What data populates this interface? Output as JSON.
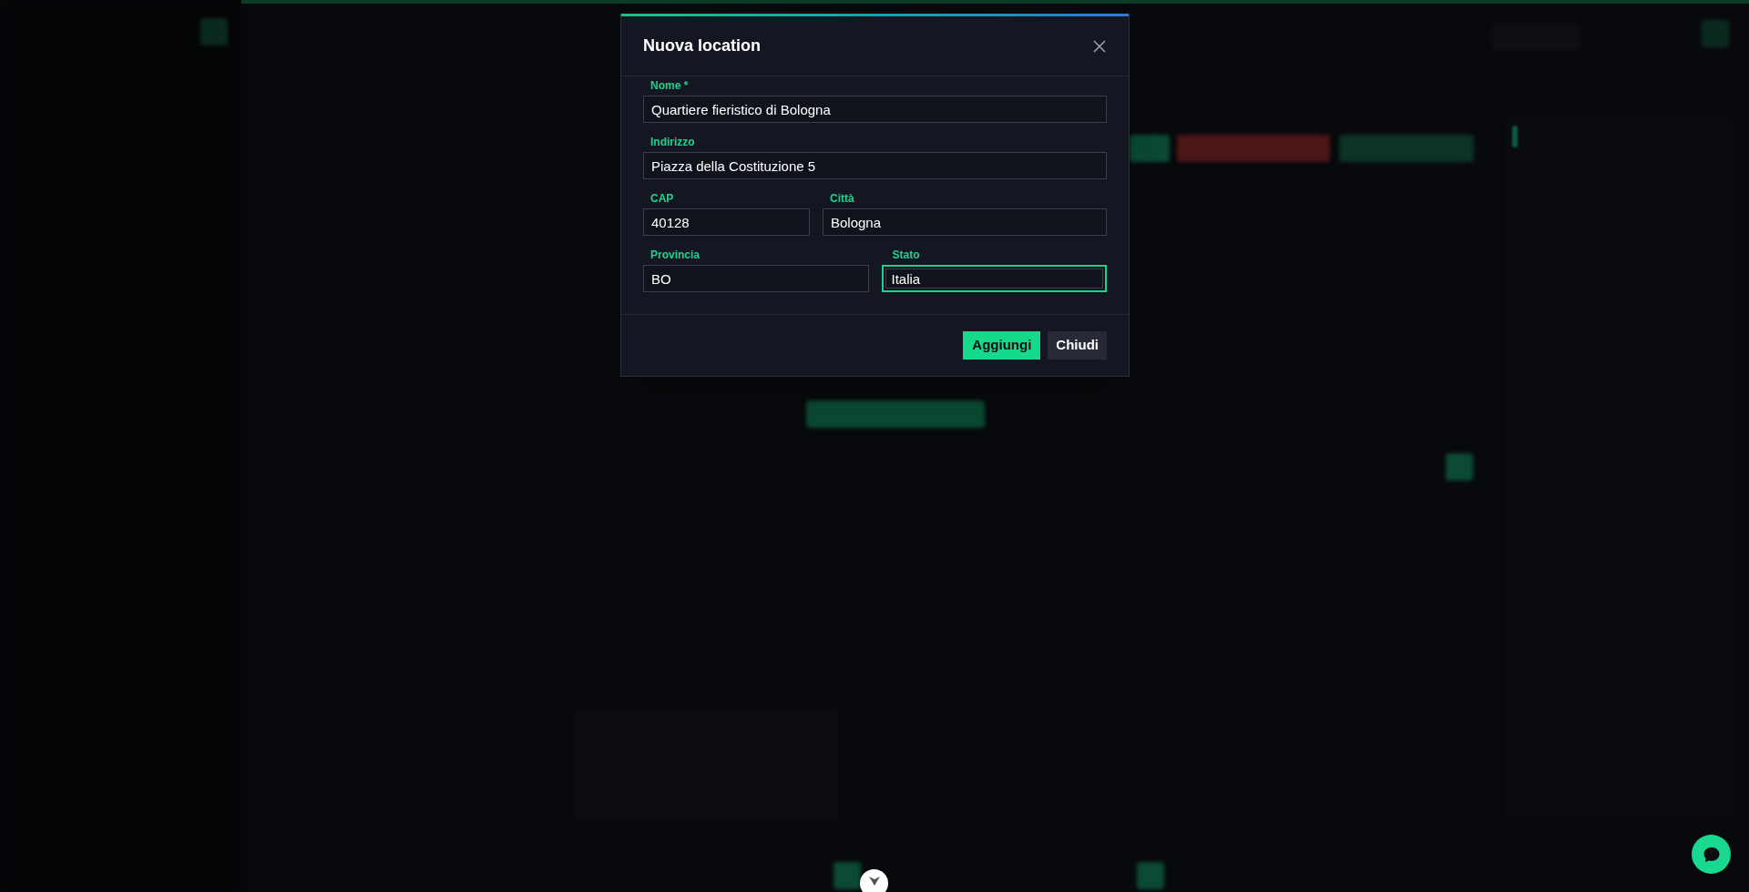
{
  "modal": {
    "title": "Nuova location",
    "rows": [
      [
        {
          "label": "Nome *",
          "value": "Quartiere fieristico di Bologna",
          "focused": false
        }
      ],
      [
        {
          "label": "Indirizzo",
          "value": "Piazza della Costituzione 5",
          "focused": false
        }
      ],
      [
        {
          "label": "CAP",
          "value": "40128",
          "focused": false
        },
        {
          "label": "Città",
          "value": "Bologna",
          "focused": false
        }
      ],
      [
        {
          "label": "Provincia",
          "value": "BO",
          "focused": false
        },
        {
          "label": "Stato",
          "value": "Italia",
          "focused": true
        }
      ]
    ],
    "buttons": [
      {
        "label": "Aggiungi",
        "kind": "primary"
      },
      {
        "label": "Chiudi",
        "kind": "secondary"
      }
    ]
  }
}
